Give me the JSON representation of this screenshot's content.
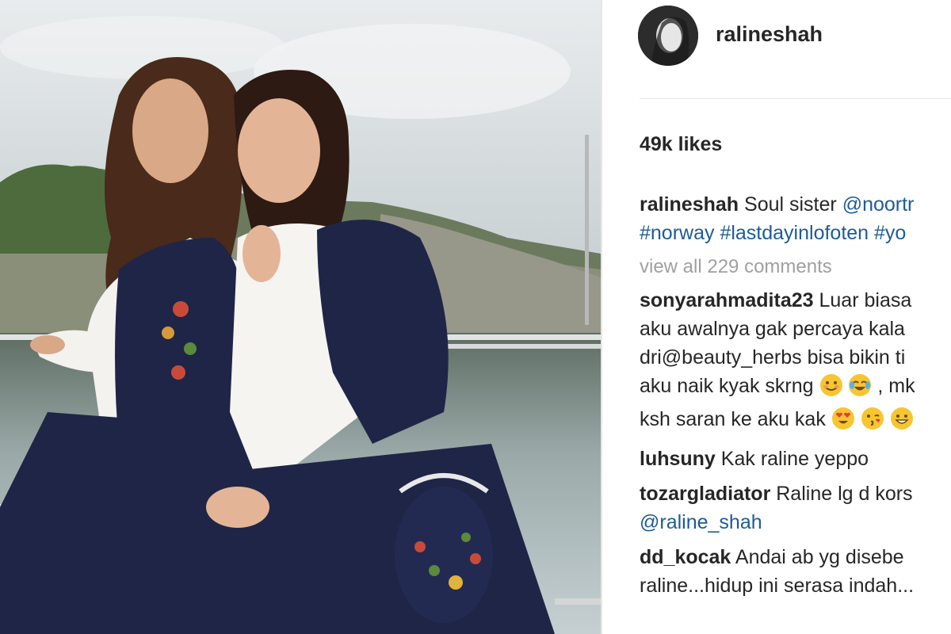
{
  "post": {
    "username": "ralineshah",
    "likes": "49k likes",
    "caption": {
      "username": "ralineshah",
      "text": "Soul sister",
      "mention": "@noortr",
      "hashtags": "#norway #lastdayinlofoten #yo"
    },
    "view_all_comments": "view all 229 comments"
  },
  "comments": [
    {
      "username": "sonyarahmadita23",
      "lines": [
        "Luar biasa",
        "aku awalnya gak percaya kala",
        "dri@beauty_herbs bisa bikin ti",
        "aku naik kyak skrng",
        ", mk",
        "ksh saran ke aku kak"
      ],
      "emojis": [
        "smiling-emoji",
        "tears-of-joy-emoji",
        "heart-eyes-emoji",
        "kiss-emoji",
        "grin-emoji"
      ]
    },
    {
      "username": "luhsuny",
      "text": "Kak raline yeppo"
    },
    {
      "username": "tozargladiator",
      "text": "Raline lg d kors",
      "mention": "@raline_shah"
    },
    {
      "username": "dd_kocak",
      "text": "Andai ab yg disebe",
      "line2": "raline...hidup ini serasa indah..."
    }
  ],
  "colors": {
    "link": "#1d5b99",
    "text": "#262626",
    "muted": "#a0a0a0",
    "vest": "#1f2547"
  }
}
